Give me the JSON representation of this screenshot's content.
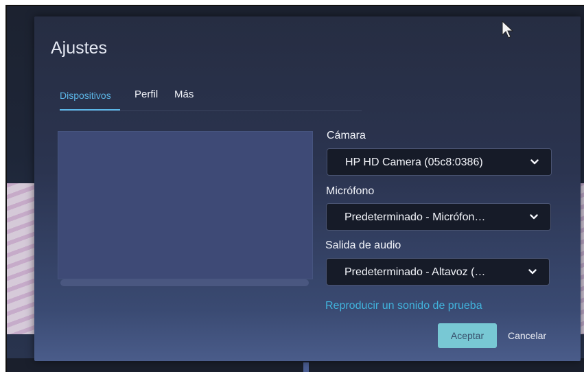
{
  "dialog": {
    "title": "Ajustes"
  },
  "tabs": [
    {
      "label": "Dispositivos",
      "active": true
    },
    {
      "label": "Perfil",
      "active": false
    },
    {
      "label": "Más",
      "active": false
    }
  ],
  "devices": {
    "camera": {
      "label": "Cámara",
      "value": "HP HD Camera (05c8:0386)"
    },
    "microphone": {
      "label": "Micrófono",
      "value": "Predeterminado - Micrófon…"
    },
    "audio_output": {
      "label": "Salida de audio",
      "value": "Predeterminado - Altavoz (…"
    },
    "test_sound_link": "Reproducir un sonido de prueba"
  },
  "buttons": {
    "accept": "Aceptar",
    "cancel": "Cancelar"
  },
  "colors": {
    "accent": "#5cb7e8",
    "link": "#41b3dc",
    "accept_button": "#78c8d4",
    "dialog_bg": "#2b3450"
  },
  "icons": {
    "select_chevron": "chevron-down-icon",
    "cursor": "mouse-pointer-icon"
  }
}
